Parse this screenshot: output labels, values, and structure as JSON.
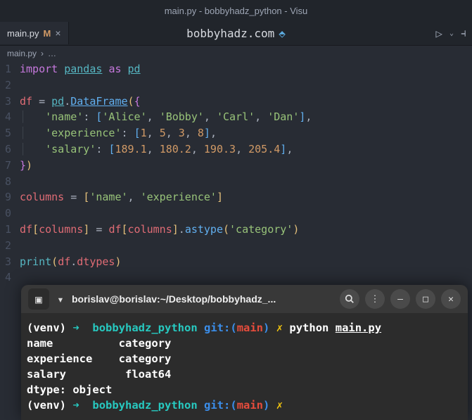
{
  "window": {
    "title": "main.py - bobbyhadz_python - Visu"
  },
  "tab": {
    "filename": "main.py",
    "modified_badge": "M"
  },
  "header": {
    "site": "bobbyhadz.com"
  },
  "breadcrumb": {
    "file": "main.py",
    "sep": "›",
    "more": "…"
  },
  "lines": [
    "1",
    "2",
    "3",
    "4",
    "5",
    "6",
    "7",
    "8",
    "9",
    "0",
    "1",
    "2",
    "3",
    "4"
  ],
  "code": {
    "l1": {
      "import": "import",
      "pandas": "pandas",
      "as": "as",
      "pd": "pd"
    },
    "l3": {
      "df": "df",
      "eq": "=",
      "pd": "pd",
      "dot": ".",
      "DataFrame": "DataFrame",
      "op": "(",
      "brace": "{"
    },
    "l4": {
      "key": "'name'",
      "sep": ":",
      "ob": "[",
      "v1": "'Alice'",
      "c": ",",
      "v2": "'Bobby'",
      "v3": "'Carl'",
      "v4": "'Dan'",
      "cb": "]",
      "tc": ","
    },
    "l5": {
      "key": "'experience'",
      "sep": ":",
      "ob": "[",
      "v1": "1",
      "c": ",",
      "v2": "5",
      "v3": "3",
      "v4": "8",
      "cb": "]",
      "tc": ","
    },
    "l6": {
      "key": "'salary'",
      "sep": ":",
      "ob": "[",
      "v1": "189.1",
      "c": ",",
      "v2": "180.2",
      "v3": "190.3",
      "v4": "205.4",
      "cb": "]",
      "tc": ","
    },
    "l7": {
      "brace": "}",
      "cp": ")"
    },
    "l9": {
      "columns": "columns",
      "eq": "=",
      "ob": "[",
      "v1": "'name'",
      "c": ",",
      "v2": "'experience'",
      "cb": "]"
    },
    "l11": {
      "df": "df",
      "ob": "[",
      "columns": "columns",
      "cb": "]",
      "eq": "=",
      "df2": "df",
      "ob2": "[",
      "columns2": "columns",
      "cb2": "]",
      "dot": ".",
      "astype": "astype",
      "op": "(",
      "arg": "'category'",
      "cp": ")"
    },
    "l13": {
      "print": "print",
      "op": "(",
      "df": "df",
      "dot": ".",
      "dtypes": "dtypes",
      "cp": ")"
    }
  },
  "terminal": {
    "title": "borislav@borislav:~/Desktop/bobbyhadz_...",
    "prompt": {
      "venv": "(venv)",
      "arrow": "➜",
      "dir": "bobbyhadz_python",
      "git": "git:(",
      "branch": "main",
      "gitc": ")",
      "dirty": "✗",
      "cmd_python": "python",
      "cmd_file": "main.py"
    },
    "out": {
      "l1a": "name",
      "l1b": "category",
      "l2a": "experience",
      "l2b": "category",
      "l3a": "salary",
      "l3b": "float64",
      "l4": "dtype: object"
    }
  }
}
